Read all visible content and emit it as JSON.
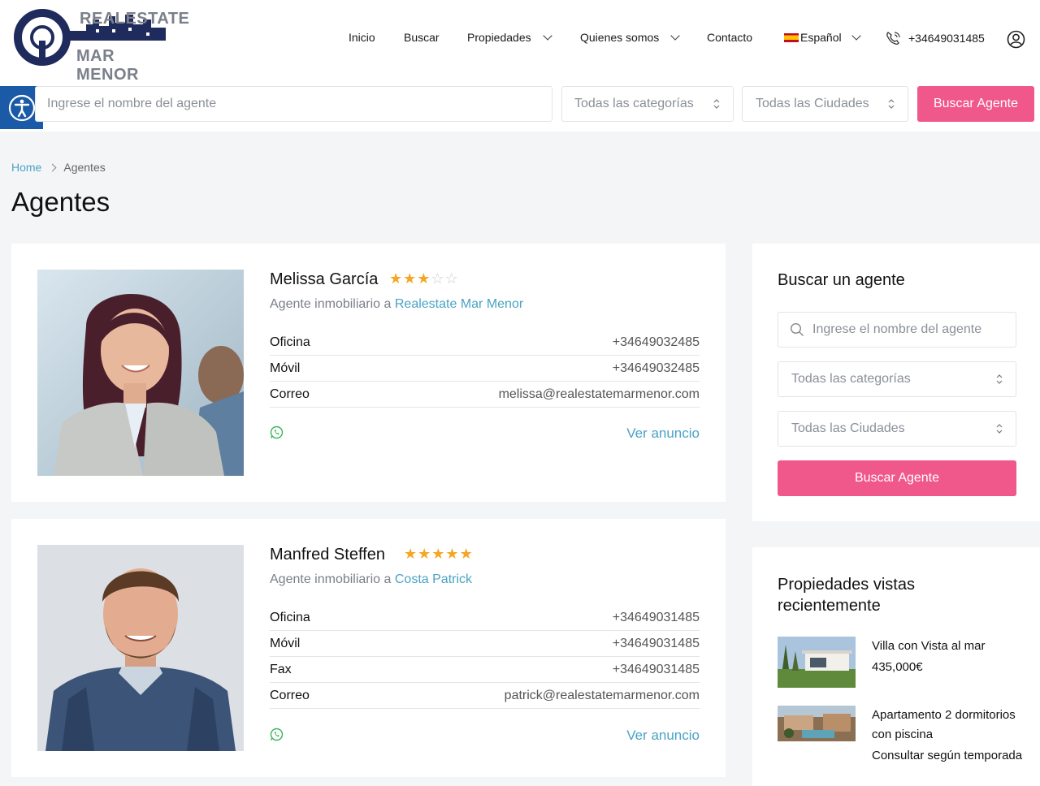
{
  "header": {
    "logo_line1": "REALESTATE",
    "logo_line2": "MAR MENOR",
    "nav": [
      {
        "label": "Inicio"
      },
      {
        "label": "Buscar"
      },
      {
        "label": "Propiedades"
      },
      {
        "label": "Quienes somos"
      },
      {
        "label": "Contacto"
      },
      {
        "label": "Español"
      }
    ],
    "phone": "+34649031485"
  },
  "searchbar": {
    "name_placeholder": "Ingrese el nombre del agente",
    "category_placeholder": "Todas las categorías",
    "city_placeholder": "Todas las Ciudades",
    "button": "Buscar Agente"
  },
  "breadcrumb": {
    "home": "Home",
    "current": "Agentes"
  },
  "page_title": "Agentes",
  "agents": [
    {
      "name": "Melissa García",
      "rating": 3,
      "max_rating": 5,
      "role_prefix": "Agente inmobiliario a",
      "company": "Realestate Mar Menor",
      "rows": [
        {
          "label": "Oficina",
          "value": "+34649032485"
        },
        {
          "label": "Móvil",
          "value": "+34649032485"
        },
        {
          "label": "Correo",
          "value": "melissa@realestatemarmenor.com"
        }
      ],
      "view_link": "Ver anuncio"
    },
    {
      "name": "Manfred Steffen",
      "rating": 5,
      "max_rating": 5,
      "role_prefix": "Agente inmobiliario a",
      "company": "Costa Patrick",
      "rows": [
        {
          "label": "Oficina",
          "value": "+34649031485"
        },
        {
          "label": "Móvil",
          "value": "+34649031485"
        },
        {
          "label": "Fax",
          "value": "+34649031485"
        },
        {
          "label": "Correo",
          "value": "patrick@realestatemarmenor.com"
        }
      ],
      "view_link": "Ver anuncio"
    }
  ],
  "sidebar": {
    "search_title": "Buscar un agente",
    "name_placeholder": "Ingrese el nombre del agente",
    "category_placeholder": "Todas las categorías",
    "city_placeholder": "Todas las Ciudades",
    "button": "Buscar Agente",
    "recent_title": "Propiedades vistas recientemente",
    "recent": [
      {
        "title": "Villa con Vista al mar",
        "price": "435,000€"
      },
      {
        "title": "Apartamento 2 dormitorios con piscina",
        "price": "Consultar según temporada"
      }
    ]
  },
  "colors": {
    "accent_pink": "#f0578a",
    "link_teal": "#4aa3c4",
    "star": "#f5a623",
    "access_blue": "#1a5aa6"
  }
}
